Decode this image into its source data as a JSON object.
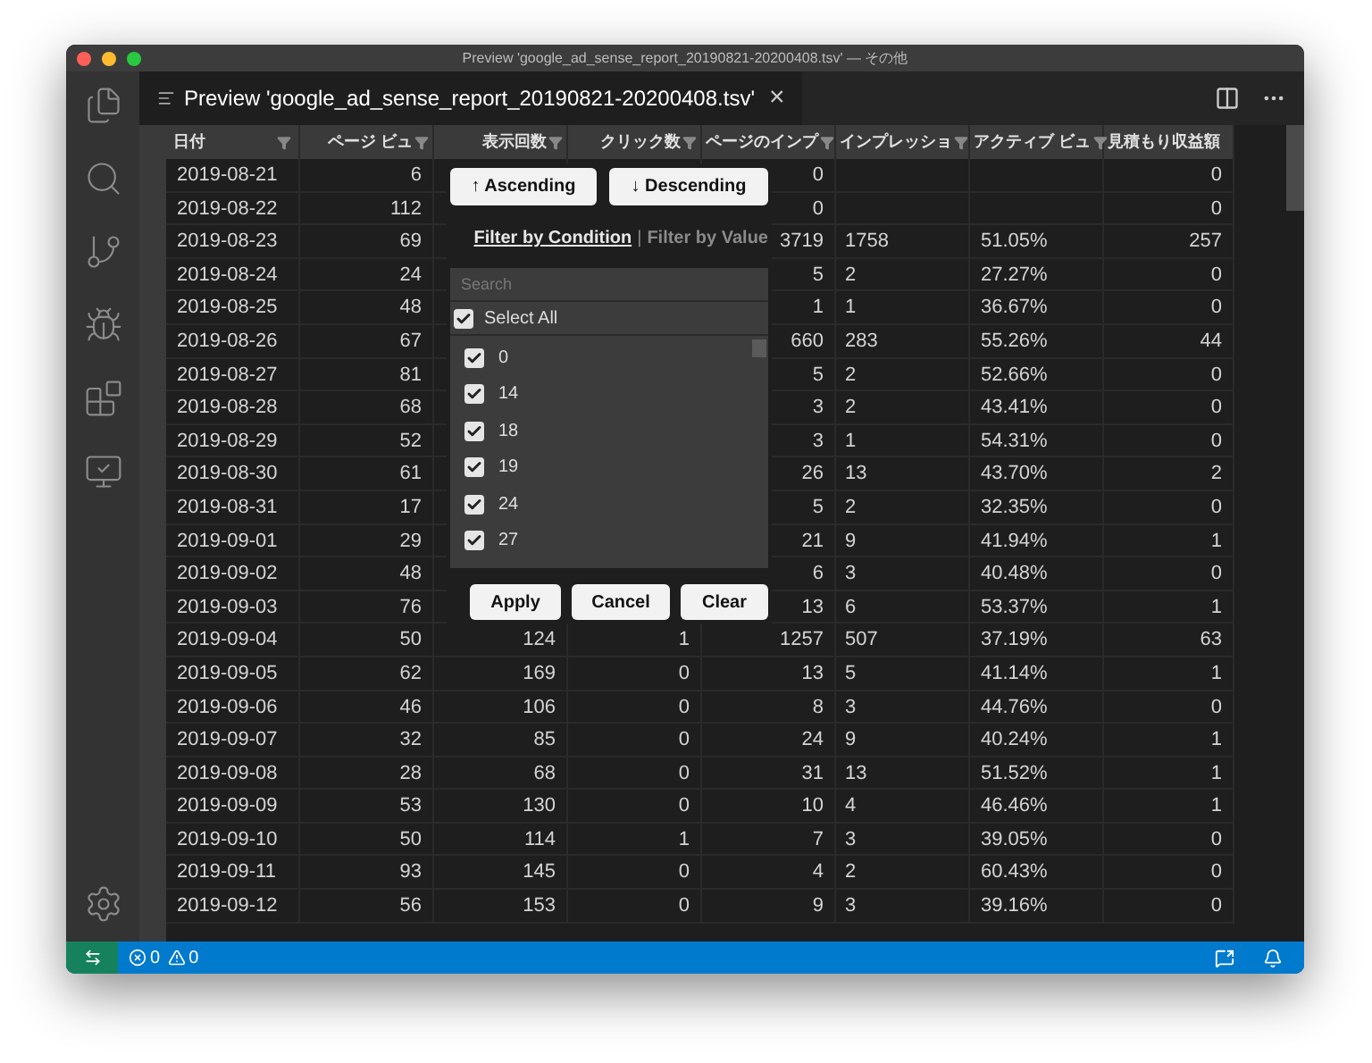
{
  "window": {
    "title": "Preview 'google_ad_sense_report_20190821-20200408.tsv' — その他"
  },
  "tab": {
    "label": "Preview 'google_ad_sense_report_20190821-20200408.tsv'",
    "close": "×"
  },
  "table": {
    "columns": [
      "日付",
      "ページ ビュ",
      "表示回数",
      "クリック数",
      "ページのインプ",
      "インプレッショ",
      "アクティブ ビュ",
      "見積もり収益額"
    ],
    "rows": [
      {
        "cells": [
          "2019-08-21",
          "6",
          null,
          null,
          "0",
          "",
          "",
          "0"
        ]
      },
      {
        "cells": [
          "2019-08-22",
          "112",
          null,
          null,
          "0",
          "",
          "",
          "0"
        ]
      },
      {
        "cells": [
          "2019-08-23",
          "69",
          null,
          null,
          "3719",
          "1758",
          "51.05%",
          "257"
        ]
      },
      {
        "cells": [
          "2019-08-24",
          "24",
          null,
          null,
          "5",
          "2",
          "27.27%",
          "0"
        ]
      },
      {
        "cells": [
          "2019-08-25",
          "48",
          null,
          null,
          "1",
          "1",
          "36.67%",
          "0"
        ]
      },
      {
        "cells": [
          "2019-08-26",
          "67",
          null,
          null,
          "660",
          "283",
          "55.26%",
          "44"
        ]
      },
      {
        "cells": [
          "2019-08-27",
          "81",
          null,
          null,
          "5",
          "2",
          "52.66%",
          "0"
        ]
      },
      {
        "cells": [
          "2019-08-28",
          "68",
          null,
          null,
          "3",
          "2",
          "43.41%",
          "0"
        ]
      },
      {
        "cells": [
          "2019-08-29",
          "52",
          null,
          null,
          "3",
          "1",
          "54.31%",
          "0"
        ]
      },
      {
        "cells": [
          "2019-08-30",
          "61",
          null,
          null,
          "26",
          "13",
          "43.70%",
          "2"
        ]
      },
      {
        "cells": [
          "2019-08-31",
          "17",
          null,
          null,
          "5",
          "2",
          "32.35%",
          "0"
        ]
      },
      {
        "cells": [
          "2019-09-01",
          "29",
          null,
          null,
          "21",
          "9",
          "41.94%",
          "1"
        ]
      },
      {
        "cells": [
          "2019-09-02",
          "48",
          null,
          null,
          "6",
          "3",
          "40.48%",
          "0"
        ]
      },
      {
        "cells": [
          "2019-09-03",
          "76",
          null,
          null,
          "13",
          "6",
          "53.37%",
          "1"
        ]
      },
      {
        "cells": [
          "2019-09-04",
          "50",
          "124",
          "1",
          "1257",
          "507",
          "37.19%",
          "63"
        ]
      },
      {
        "cells": [
          "2019-09-05",
          "62",
          "169",
          "0",
          "13",
          "5",
          "41.14%",
          "1"
        ]
      },
      {
        "cells": [
          "2019-09-06",
          "46",
          "106",
          "0",
          "8",
          "3",
          "44.76%",
          "0"
        ]
      },
      {
        "cells": [
          "2019-09-07",
          "32",
          "85",
          "0",
          "24",
          "9",
          "40.24%",
          "1"
        ]
      },
      {
        "cells": [
          "2019-09-08",
          "28",
          "68",
          "0",
          "31",
          "13",
          "51.52%",
          "1"
        ]
      },
      {
        "cells": [
          "2019-09-09",
          "53",
          "130",
          "0",
          "10",
          "4",
          "46.46%",
          "1"
        ]
      },
      {
        "cells": [
          "2019-09-10",
          "50",
          "114",
          "1",
          "7",
          "3",
          "39.05%",
          "0"
        ]
      },
      {
        "cells": [
          "2019-09-11",
          "93",
          "145",
          "0",
          "4",
          "2",
          "60.43%",
          "0"
        ]
      },
      {
        "cells": [
          "2019-09-12",
          "56",
          "153",
          "0",
          "9",
          "3",
          "39.16%",
          "0"
        ]
      }
    ]
  },
  "filter_popup": {
    "sort_buttons": [
      "↑ Ascending",
      "↓ Descending"
    ],
    "modes": [
      {
        "label": "Filter by Condition",
        "selected": true
      },
      {
        "label": "Filter by Value",
        "selected": false
      }
    ],
    "separator": "|",
    "search": {
      "placeholder": "Search"
    },
    "select_all": {
      "label": "Select All",
      "checked": true
    },
    "values": [
      {
        "label": "0",
        "checked": true
      },
      {
        "label": "14",
        "checked": true
      },
      {
        "label": "18",
        "checked": true
      },
      {
        "label": "19",
        "checked": true
      },
      {
        "label": "24",
        "checked": true
      },
      {
        "label": "27",
        "checked": true
      }
    ],
    "actions": [
      "Apply",
      "Cancel",
      "Clear"
    ]
  },
  "status_bar": {
    "errors": "0",
    "warnings": "0"
  }
}
